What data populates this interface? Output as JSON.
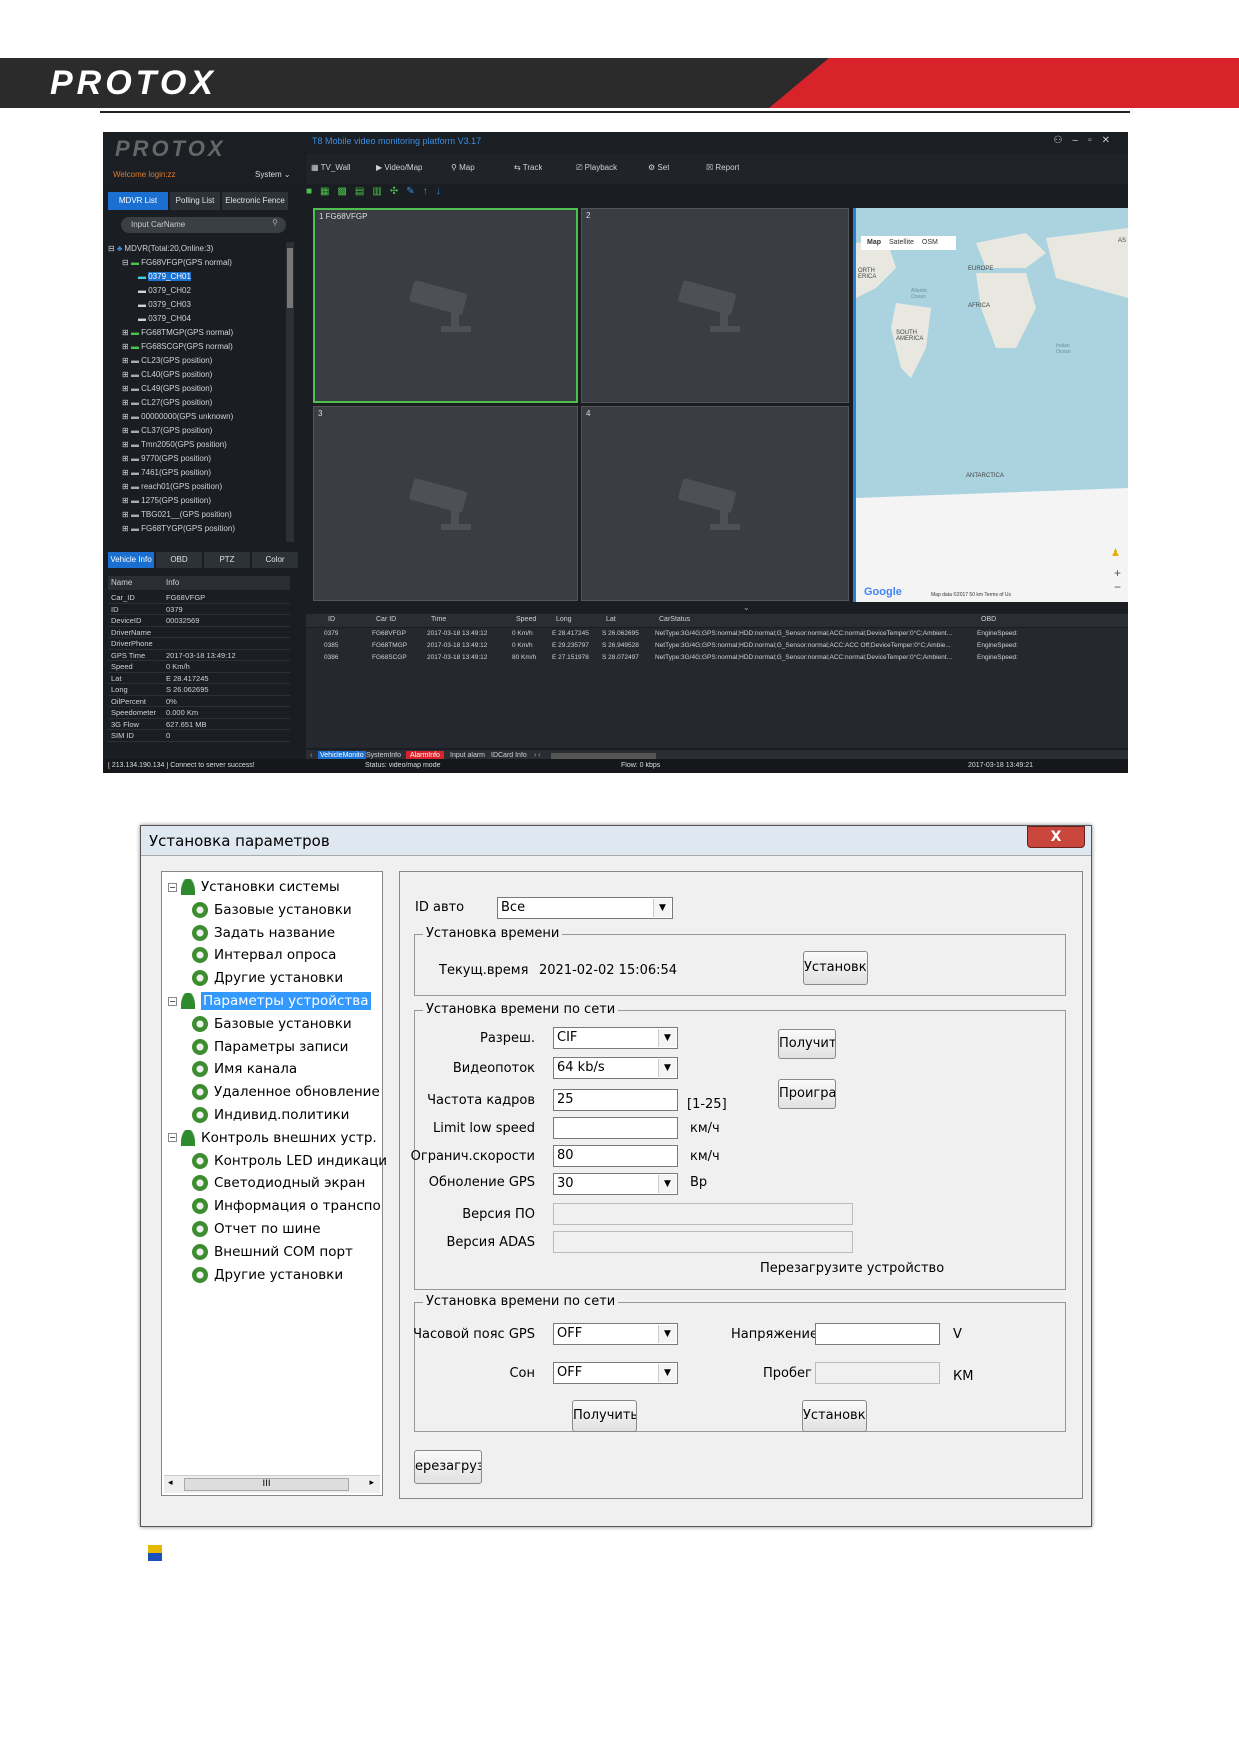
{
  "brand": {
    "logo_text": "PROTOX"
  },
  "app": {
    "title": "T8 Mobile video monitoring platform V3.17",
    "welcome": "Welcome login:zz",
    "system_menu": "System",
    "toolbar": [
      "TV_Wall",
      "Video/Map",
      "Map",
      "Track",
      "Playback",
      "Set",
      "Report"
    ],
    "tabs": [
      "MDVR List",
      "Polling List",
      "Electronic Fence"
    ],
    "search_placeholder": "Input CarName",
    "tree_root": "MDVR(Total:20,Online:3)",
    "tree_vehicle": "FG68VFGP(GPS normal)",
    "tree_channels": [
      "0379_CH01",
      "0379_CH02",
      "0379_CH03",
      "0379_CH04"
    ],
    "tree_items": [
      "FG68TMGP(GPS normal)",
      "FG68SCGP(GPS normal)",
      "CL23(GPS position)",
      "CL40(GPS position)",
      "CL49(GPS position)",
      "CL27(GPS position)",
      "00000000(GPS unknown)",
      "CL37(GPS position)",
      "Tmn2050(GPS position)",
      "9770(GPS position)",
      "7461(GPS position)",
      "reach01(GPS position)",
      "1275(GPS position)",
      "TBG021__(GPS position)",
      "FG68TYGP(GPS position)"
    ],
    "info_tabs": [
      "Vehicle Info",
      "OBD",
      "PTZ",
      "Color"
    ],
    "info_header": [
      "Name",
      "Info"
    ],
    "info_rows": [
      [
        "Car_ID",
        "FG68VFGP"
      ],
      [
        "ID",
        "0379"
      ],
      [
        "DeviceID",
        "00032569"
      ],
      [
        "DriverName",
        ""
      ],
      [
        "DriverPhone",
        ""
      ],
      [
        "GPS Time",
        "2017-03-18 13:49:12"
      ],
      [
        "Speed",
        "0 Km/h"
      ],
      [
        "Lat",
        "E 28.417245"
      ],
      [
        "Long",
        "S 26.062695"
      ],
      [
        "OilPercent",
        "0%"
      ],
      [
        "Speedometer",
        "0.000 Km"
      ],
      [
        "3G Flow",
        "627.651 MB"
      ],
      [
        "SIM ID",
        "0"
      ]
    ],
    "cams": [
      "1 FG68VFGP",
      "2",
      "3",
      "4"
    ],
    "map": {
      "tabs": [
        "Map",
        "Satellite",
        "OSM"
      ],
      "labels": [
        "EUROPE",
        "AFRICA",
        "SOUTH AMERICA",
        "ANTARCTICA",
        "ORTH ERICA",
        "Atlantic Ocean",
        "Indian Ocean",
        "AS"
      ],
      "google": "Google",
      "footer": "Map data ©2017   50 km   Terms of Us"
    },
    "grid_header": [
      "ID",
      "Car ID",
      "Time",
      "Speed",
      "Long",
      "Lat",
      "CarStatus",
      "OBD"
    ],
    "grid_rows": [
      [
        "0379",
        "FG68VFGP",
        "2017-03-18 13:49:12",
        "0 Km/h",
        "E 28.417245",
        "S 26.062695",
        "NetType:3G/4G;GPS:normal;HDD:normal;G_Sensor:normal;ACC:normal;DeviceTemper:0°C;Ambient...",
        "EngineSpeed:"
      ],
      [
        "0385",
        "FG68TMGP",
        "2017-03-18 13:49:12",
        "0 Km/h",
        "E 29.235797",
        "S 26.949528",
        "NetType:3G/4G;GPS:normal;HDD:normal;G_Sensor:normal;ACC:ACC Off;DeviceTemper:0°C;Ambie...",
        "EngineSpeed:"
      ],
      [
        "0386",
        "FG68SCGP",
        "2017-03-18 13:49:12",
        "80 Km/h",
        "E 27.151978",
        "S 28.072497",
        "NetType:3G/4G;GPS:normal;HDD:normal;G_Sensor:normal;ACC:normal;DeviceTemper:0°C;Ambient...",
        "EngineSpeed:"
      ]
    ],
    "bottom_tabs": [
      "VehicleMonito",
      "SystemInfo",
      "AlarmInfo",
      "Input alarm",
      "IDCard Info"
    ],
    "status": [
      "[ 213.134.190.134 ] Connect to server success!",
      "Status: video/map mode",
      "Flow: 0 kbps",
      "2017-03-18 13:49:21"
    ]
  },
  "dialog": {
    "title": "Установка параметров",
    "close": "X",
    "tree": [
      {
        "label": "Установки системы",
        "type": "group"
      },
      {
        "label": "Базовые установки",
        "type": "item"
      },
      {
        "label": "Задать название",
        "type": "item"
      },
      {
        "label": "Интервал опроса",
        "type": "item"
      },
      {
        "label": "Другие установки",
        "type": "item"
      },
      {
        "label": "Параметры устройства",
        "type": "group",
        "selected": true
      },
      {
        "label": "Базовые установки",
        "type": "item"
      },
      {
        "label": "Параметры записи",
        "type": "item"
      },
      {
        "label": "Имя канала",
        "type": "item"
      },
      {
        "label": "Удаленное обновление",
        "type": "item"
      },
      {
        "label": "Индивид.политики",
        "type": "item"
      },
      {
        "label": "Контроль внешних устр.",
        "type": "group"
      },
      {
        "label": "Контроль LED индикаци",
        "type": "item"
      },
      {
        "label": "Светодиодный экран",
        "type": "item"
      },
      {
        "label": "Информация о транспо",
        "type": "item"
      },
      {
        "label": "Отчет по шине",
        "type": "item"
      },
      {
        "label": "Внешний COM порт",
        "type": "item"
      },
      {
        "label": "Другие установки",
        "type": "item"
      }
    ],
    "scroll_label": "III",
    "id_auto_label": "ID авто",
    "id_auto_value": "Все",
    "time_group": "Установка времени",
    "cur_time_label": "Текущ.время",
    "cur_time_value": "2021-02-02 15:06:54",
    "set_btn": "Установки",
    "net_group": "Установка времени по сети",
    "res_label": "Разреш.",
    "res_value": "CIF",
    "stream_label": "Видеопоток",
    "stream_value": "64 kb/s",
    "fps_label": "Частота кадров",
    "fps_value": "25",
    "fps_range": "[1-25]",
    "limit_label": "Limit low speed",
    "limit_value": "",
    "kmh1": "км/ч",
    "speed_label": "Огранич.скорости",
    "speed_value": "80",
    "kmh2": "км/ч",
    "gps_label": "Обноление GPS",
    "gps_value": "30",
    "gps_unit": "Вр",
    "fw_label": "Версия ПО",
    "adas_label": "Версия ADAS",
    "get_btn": "Получить",
    "play_btn": "Проиграть",
    "reboot_note": "Перезагрузите устройство",
    "net_group2": "Установка времени по сети",
    "tz_label": "Часовой пояс GPS",
    "tz_value": "OFF",
    "sleep_label": "Сон",
    "sleep_value": "OFF",
    "volt_label": "Напряжение",
    "volt_unit": "V",
    "mileage_label": "Пробег",
    "mileage_unit": "КМ",
    "get_btn2": "Получить",
    "set_btn2": "Установки",
    "reboot_btn": "ерезагрузі"
  }
}
